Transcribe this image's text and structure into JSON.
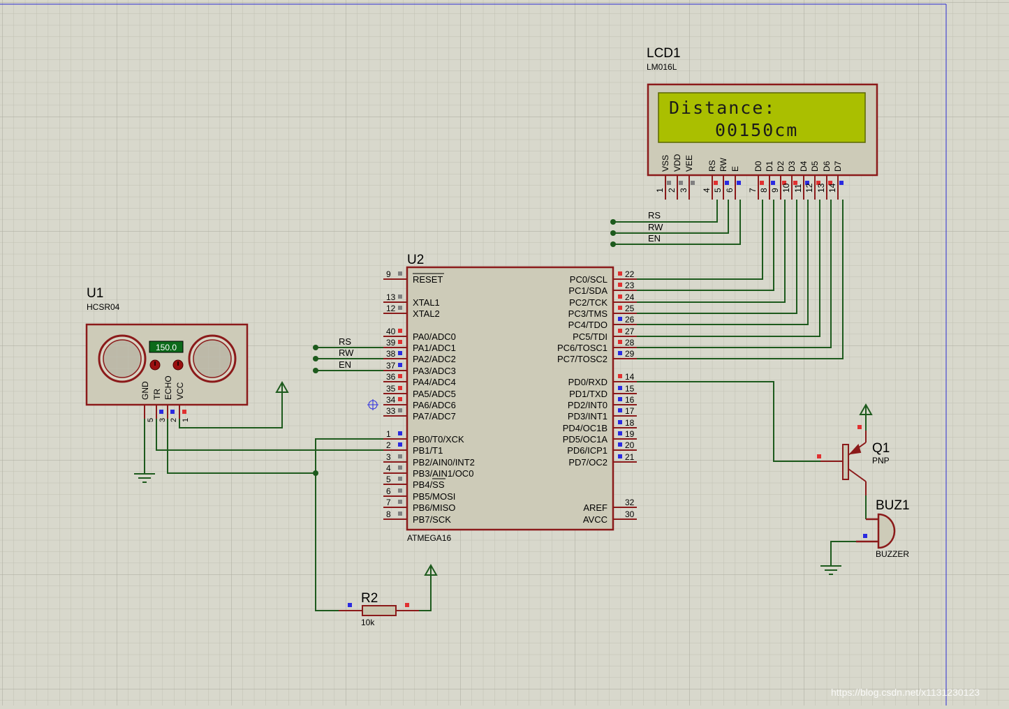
{
  "sheet": {
    "watermark": "https://blog.csdn.net/x1131230123"
  },
  "colors": {
    "wire": "#1d5a1d",
    "body": "#8b1a1a",
    "fill": "#cdcbb8",
    "lcd_screen": "#aabf00",
    "pin_red": "#e03030",
    "pin_blue": "#2a2ae0",
    "pin_gray": "#808080"
  },
  "lcd": {
    "ref": "LCD1",
    "part": "LM016L",
    "line1": "Distance:",
    "line2": "00150cm",
    "pins": [
      {
        "name": "VSS",
        "num": "1"
      },
      {
        "name": "VDD",
        "num": "2"
      },
      {
        "name": "VEE",
        "num": "3"
      },
      {
        "name": "RS",
        "num": "4"
      },
      {
        "name": "RW",
        "num": "5"
      },
      {
        "name": "E",
        "num": "6"
      },
      {
        "name": "D0",
        "num": "7"
      },
      {
        "name": "D1",
        "num": "8"
      },
      {
        "name": "D2",
        "num": "9"
      },
      {
        "name": "D3",
        "num": "10"
      },
      {
        "name": "D4",
        "num": "11"
      },
      {
        "name": "D5",
        "num": "12"
      },
      {
        "name": "D6",
        "num": "13"
      },
      {
        "name": "D7",
        "num": "14"
      }
    ],
    "net_labels": [
      "RS",
      "RW",
      "EN"
    ]
  },
  "mcu": {
    "ref": "U2",
    "part": "ATMEGA16",
    "left_pins": [
      {
        "name": "RESET",
        "num": "9"
      },
      {
        "name": "XTAL1",
        "num": "13"
      },
      {
        "name": "XTAL2",
        "num": "12"
      },
      {
        "name": "PA0/ADC0",
        "num": "40"
      },
      {
        "name": "PA1/ADC1",
        "num": "39"
      },
      {
        "name": "PA2/ADC2",
        "num": "38"
      },
      {
        "name": "PA3/ADC3",
        "num": "37"
      },
      {
        "name": "PA4/ADC4",
        "num": "36"
      },
      {
        "name": "PA5/ADC5",
        "num": "35"
      },
      {
        "name": "PA6/ADC6",
        "num": "34"
      },
      {
        "name": "PA7/ADC7",
        "num": "33"
      },
      {
        "name": "PB0/T0/XCK",
        "num": "1"
      },
      {
        "name": "PB1/T1",
        "num": "2"
      },
      {
        "name": "PB2/AIN0/INT2",
        "num": "3"
      },
      {
        "name": "PB3/AIN1/OC0",
        "num": "4"
      },
      {
        "name": "PB4/SS",
        "num": "5"
      },
      {
        "name": "PB5/MOSI",
        "num": "6"
      },
      {
        "name": "PB6/MISO",
        "num": "7"
      },
      {
        "name": "PB7/SCK",
        "num": "8"
      }
    ],
    "right_pins": [
      {
        "name": "PC0/SCL",
        "num": "22"
      },
      {
        "name": "PC1/SDA",
        "num": "23"
      },
      {
        "name": "PC2/TCK",
        "num": "24"
      },
      {
        "name": "PC3/TMS",
        "num": "25"
      },
      {
        "name": "PC4/TDO",
        "num": "26"
      },
      {
        "name": "PC5/TDI",
        "num": "27"
      },
      {
        "name": "PC6/TOSC1",
        "num": "28"
      },
      {
        "name": "PC7/TOSC2",
        "num": "29"
      },
      {
        "name": "PD0/RXD",
        "num": "14"
      },
      {
        "name": "PD1/TXD",
        "num": "15"
      },
      {
        "name": "PD2/INT0",
        "num": "16"
      },
      {
        "name": "PD3/INT1",
        "num": "17"
      },
      {
        "name": "PD4/OC1B",
        "num": "18"
      },
      {
        "name": "PD5/OC1A",
        "num": "19"
      },
      {
        "name": "PD6/ICP1",
        "num": "20"
      },
      {
        "name": "PD7/OC2",
        "num": "21"
      },
      {
        "name": "AREF",
        "num": "32"
      },
      {
        "name": "AVCC",
        "num": "30"
      }
    ],
    "net_labels": [
      "RS",
      "RW",
      "EN"
    ]
  },
  "sensor": {
    "ref": "U1",
    "part": "HCSR04",
    "readout": "150.0",
    "pins": [
      {
        "name": "GND",
        "num": "5"
      },
      {
        "name": "TR",
        "num": "3"
      },
      {
        "name": "ECHO",
        "num": "2"
      },
      {
        "name": "VCC",
        "num": "1"
      }
    ]
  },
  "transistor": {
    "ref": "Q1",
    "part": "PNP"
  },
  "buzzer": {
    "ref": "BUZ1",
    "part": "BUZZER"
  },
  "resistor": {
    "ref": "R2",
    "value": "10k"
  }
}
